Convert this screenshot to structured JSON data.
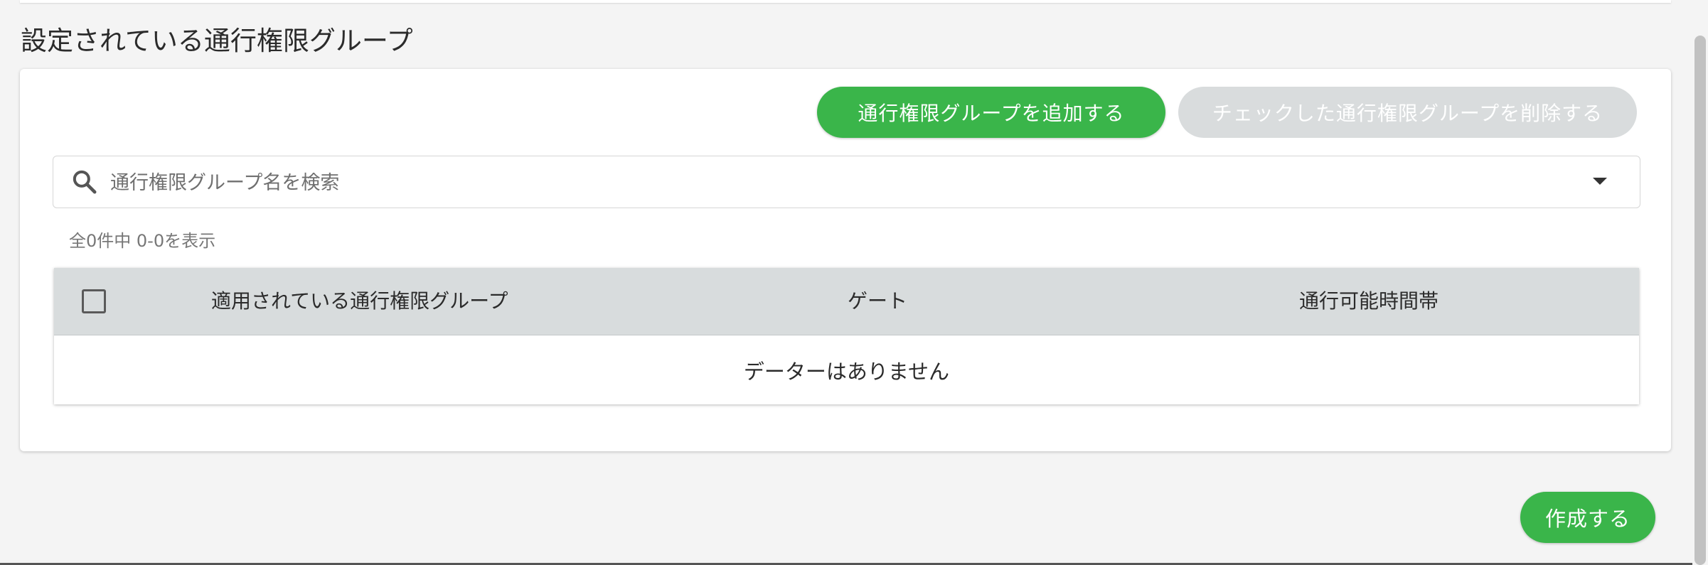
{
  "section": {
    "title": "設定されている通行権限グループ"
  },
  "toolbar": {
    "add_label": "通行権限グループを追加する",
    "delete_label": "チェックした通行権限グループを削除する"
  },
  "search": {
    "placeholder": "通行権限グループ名を検索",
    "value": ""
  },
  "results": {
    "count_text": "全0件中 0-0を表示"
  },
  "table": {
    "columns": [
      "適用されている通行権限グループ",
      "ゲート",
      "通行可能時間帯"
    ],
    "rows": [],
    "empty_text": "データーはありません"
  },
  "footer": {
    "create_label": "作成する"
  },
  "colors": {
    "primary": "#3ab54a",
    "disabled": "#d9dcdd",
    "header_bg": "#d8dcdd"
  },
  "icons": {
    "search": "search-icon",
    "dropdown": "caret-down-icon",
    "checkbox": "checkbox-unchecked-icon"
  }
}
